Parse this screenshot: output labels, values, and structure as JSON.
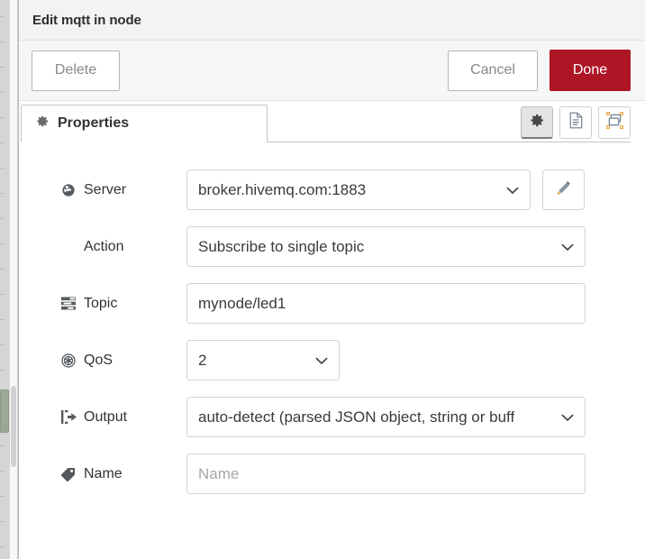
{
  "dialog": {
    "title": "Edit mqtt in node"
  },
  "actions": {
    "delete_label": "Delete",
    "cancel_label": "Cancel",
    "done_label": "Done",
    "done_color": "#ad1625"
  },
  "tabs": [
    {
      "label": "Properties",
      "icon": "gear-icon",
      "active": true
    }
  ],
  "tab_tools": [
    {
      "name": "properties-view-button",
      "icon": "gear-icon",
      "active": true
    },
    {
      "name": "description-view-button",
      "icon": "document-icon",
      "active": false
    },
    {
      "name": "appearance-view-button",
      "icon": "node-appearance-icon",
      "active": false
    }
  ],
  "form": {
    "server": {
      "icon": "globe-icon",
      "label": "Server",
      "value": "broker.hivemq.com:1883",
      "edit_button": "pencil-icon"
    },
    "action": {
      "icon": null,
      "label": "Action",
      "value": "Subscribe to single topic"
    },
    "topic": {
      "icon": "tasks-icon",
      "label": "Topic",
      "value": "mynode/led1",
      "placeholder": ""
    },
    "qos": {
      "icon": "empire-icon",
      "label": "QoS",
      "value": "2"
    },
    "output": {
      "icon": "sign-out-icon",
      "label": "Output",
      "value": "auto-detect (parsed JSON object, string or buff"
    },
    "name": {
      "icon": "tag-icon",
      "label": "Name",
      "value": "",
      "placeholder": "Name"
    }
  }
}
